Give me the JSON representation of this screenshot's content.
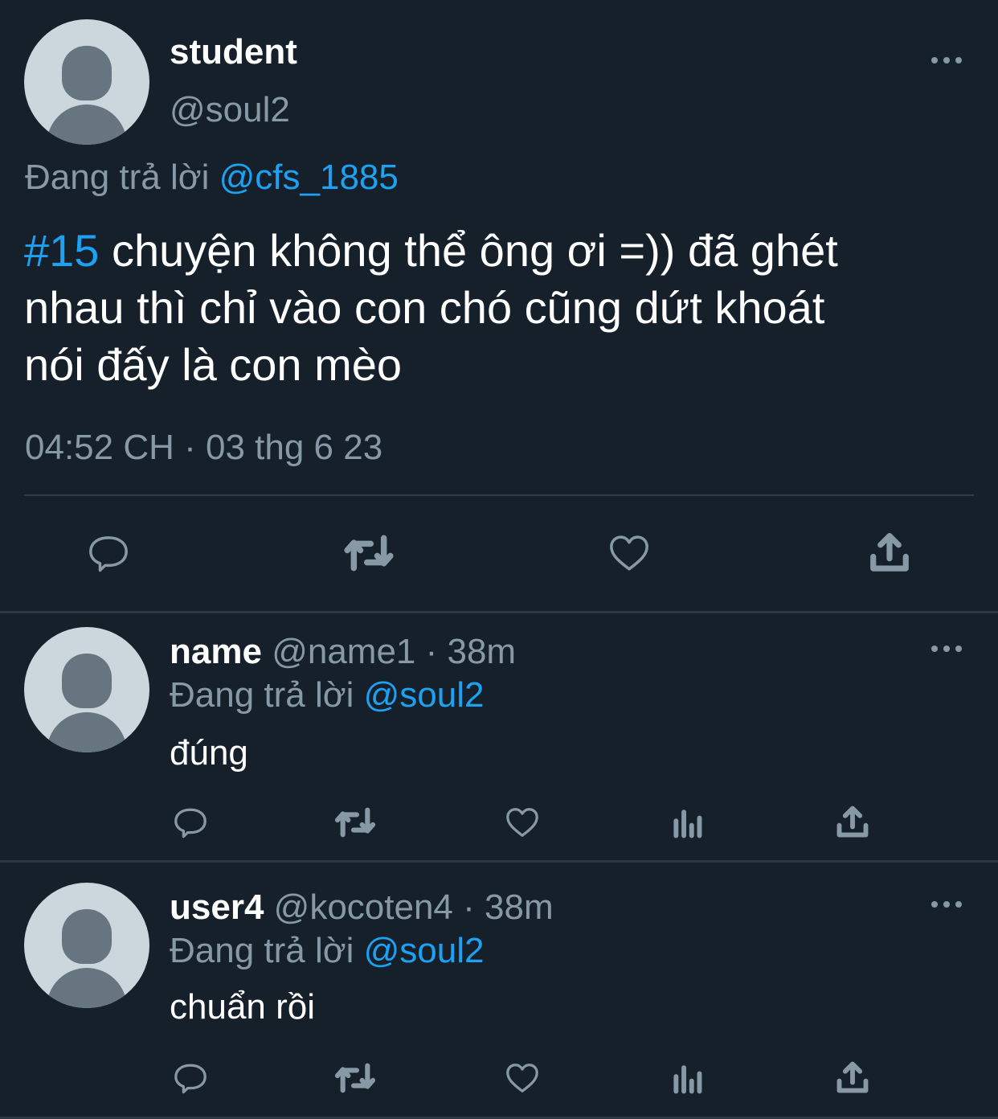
{
  "main_tweet": {
    "display_name": "student",
    "handle": "@soul2",
    "reply_prefix": "Đang trả lời",
    "reply_to": "@cfs_1885",
    "hashtag": "#15",
    "text": "chuyện không thể ông ơi =)) đã ghét",
    "text_line2": "nhau thì chỉ vào con chó cũng dứt khoát",
    "text_line3": "nói đấy là con mèo",
    "timestamp": "04:52 CH · 03 thg 6 23",
    "actions": [
      "reply-icon",
      "retweet-icon",
      "like-icon",
      "share-icon"
    ]
  },
  "replies": [
    {
      "display_name": "name",
      "meta": "@name1 · 38m",
      "reply_prefix": "Đang trả lời",
      "reply_to": "@soul2",
      "text": "đúng",
      "actions": [
        "reply-icon",
        "retweet-icon",
        "like-icon",
        "analytics-icon",
        "share-icon"
      ]
    },
    {
      "display_name": "user4",
      "meta": "@kocoten4 · 38m",
      "reply_prefix": "Đang trả lời",
      "reply_to": "@soul2",
      "text": "chuẩn rồi",
      "actions": [
        "reply-icon",
        "retweet-icon",
        "like-icon",
        "analytics-icon",
        "share-icon"
      ]
    }
  ],
  "colors": {
    "background": "#15202b",
    "text": "#ffffff",
    "muted": "#8899a6",
    "accent": "#1da1f2",
    "divider": "#2c3844"
  }
}
